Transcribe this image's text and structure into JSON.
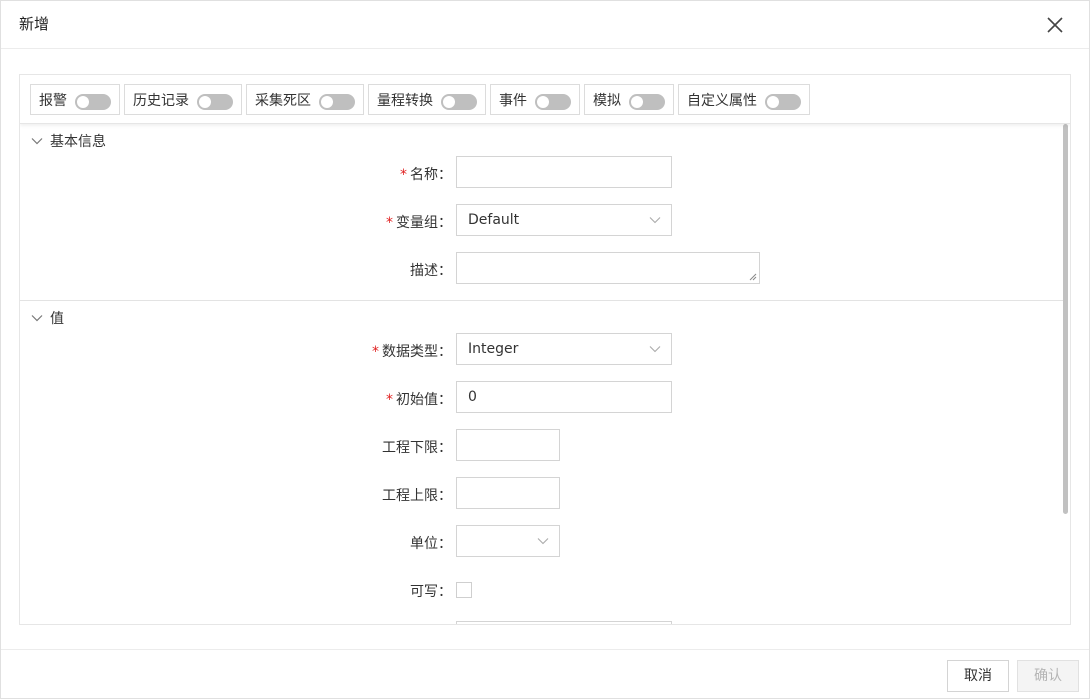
{
  "dialog": {
    "title": "新增"
  },
  "toolbar": {
    "items": [
      {
        "label": "报警",
        "enabled": false
      },
      {
        "label": "历史记录",
        "enabled": false
      },
      {
        "label": "采集死区",
        "enabled": false
      },
      {
        "label": "量程转换",
        "enabled": false
      },
      {
        "label": "事件",
        "enabled": false
      },
      {
        "label": "模拟",
        "enabled": false
      },
      {
        "label": "自定义属性",
        "enabled": false
      }
    ]
  },
  "basic_info": {
    "title": "基本信息",
    "name": {
      "label": "名称：",
      "value": ""
    },
    "group": {
      "label": "变量组：",
      "value": "Default"
    },
    "desc": {
      "label": "描述：",
      "value": ""
    }
  },
  "value_section": {
    "title": "值",
    "data_type": {
      "label": "数据类型：",
      "value": "Integer"
    },
    "initial": {
      "label": "初始值：",
      "value": "0"
    },
    "eng_low": {
      "label": "工程下限：",
      "value": ""
    },
    "eng_high": {
      "label": "工程上限：",
      "value": ""
    },
    "unit": {
      "label": "单位：",
      "value": ""
    },
    "writable": {
      "label": "可写：",
      "checked": false
    }
  },
  "footer": {
    "cancel_label": "取消",
    "confirm_label": "确认"
  },
  "colors": {
    "required": "#e02020",
    "switch_off": "#bfbfbf",
    "border": "#d4d4d4"
  }
}
